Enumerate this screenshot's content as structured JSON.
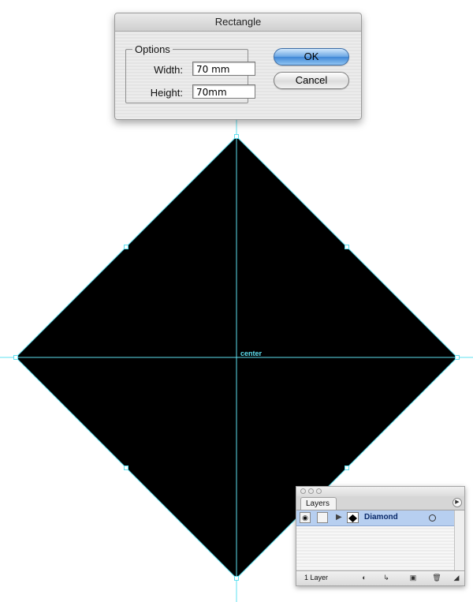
{
  "dialog": {
    "title": "Rectangle",
    "options_legend": "Options",
    "width_label": "Width:",
    "width_value": "70 mm",
    "height_label": "Height:",
    "height_value": "70mm",
    "ok_label": "OK",
    "cancel_label": "Cancel"
  },
  "canvas": {
    "center_label": "center",
    "shape_fill": "#000000",
    "guide_color": "#5ee0f0"
  },
  "layers_panel": {
    "tab_label": "Layers",
    "layer_name": "Diamond",
    "layer_count": "1 Layer",
    "selected_row_color": "#b7cff0",
    "icons": [
      "eye-icon",
      "lock-toggle-icon",
      "expand-arrow-icon",
      "layer-thumbnail-icon",
      "target-icon",
      "panel-menu-icon",
      "make-clipping-mask-icon",
      "create-sublayer-icon",
      "create-layer-icon",
      "trash-icon"
    ]
  }
}
